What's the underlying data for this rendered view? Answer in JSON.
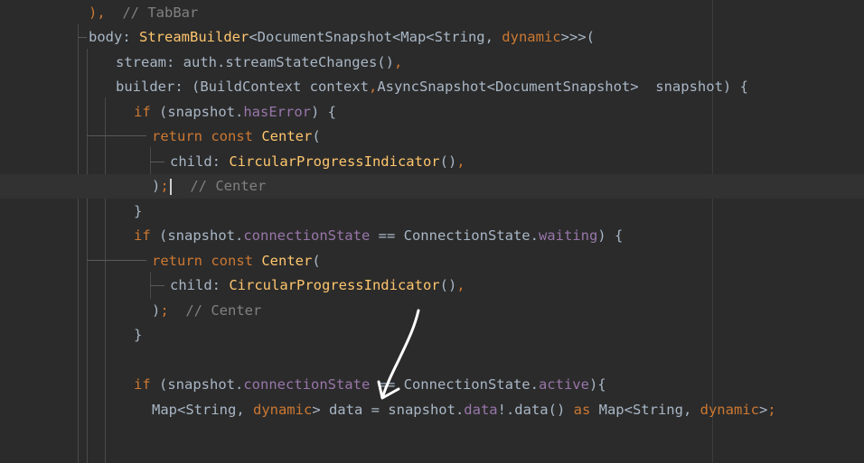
{
  "code": {
    "l1": {
      "p1": "), ",
      "c1": " // TabBar"
    },
    "l2": {
      "t1": "body: ",
      "t2": "StreamBuilder",
      "t3": "<DocumentSnapshot<Map<String, ",
      "t4": "dynamic",
      "t5": ">>>("
    },
    "l3": {
      "t1": "stream: auth.streamStateChanges()",
      "t2": ","
    },
    "l4": {
      "t1": "builder: (BuildContext context",
      "t2": ",",
      "t3": "AsyncSnapshot<DocumentSnapshot>  snapshot) {"
    },
    "l5": {
      "t1": "if",
      "t2": " (snapshot.",
      "t3": "hasError",
      "t4": ") {"
    },
    "l6": {
      "t1": "return const ",
      "t2": "Center",
      "t3": "("
    },
    "l7": {
      "t1": "child: ",
      "t2": "CircularProgressIndicator",
      "t3": "()",
      "t4": ","
    },
    "l8": {
      "t1": ")",
      "t2": ";",
      "c1": "  // Center"
    },
    "l9": {
      "t1": "}"
    },
    "l10": {
      "t1": "if",
      "t2": " (snapshot.",
      "t3": "connectionState",
      "t4": " == ConnectionState.",
      "t5": "waiting",
      "t6": ") {"
    },
    "l11": {
      "t1": "return const ",
      "t2": "Center",
      "t3": "("
    },
    "l12": {
      "t1": "child: ",
      "t2": "CircularProgressIndicator",
      "t3": "()",
      "t4": ","
    },
    "l13": {
      "t1": ")",
      "t2": ";",
      "c1": "  // Center"
    },
    "l14": {
      "t1": "}"
    },
    "l15": {
      "t1": "if",
      "t2": " (snapshot.",
      "t3": "connectionState",
      "t4": " == ConnectionState.",
      "t5": "active",
      "t6": "){"
    },
    "l16": {
      "t1": "Map<String, ",
      "t2": "dynamic",
      "t3": "> data = snapshot.",
      "t4": "data",
      "t5": "!.data() ",
      "t6": "as",
      "t7": " Map<String, ",
      "t8": "dynamic",
      "t9": ">",
      "t10": ";"
    }
  },
  "colors": {
    "background": "#2b2b2b",
    "default_text": "#a9b7c6",
    "keyword": "#cc7832",
    "class_name": "#ffc66d",
    "property": "#9876aa",
    "comment": "#808080",
    "annotation_arrow": "#ffffff"
  },
  "annotation": {
    "icon": "hand-drawn-arrow-icon"
  }
}
